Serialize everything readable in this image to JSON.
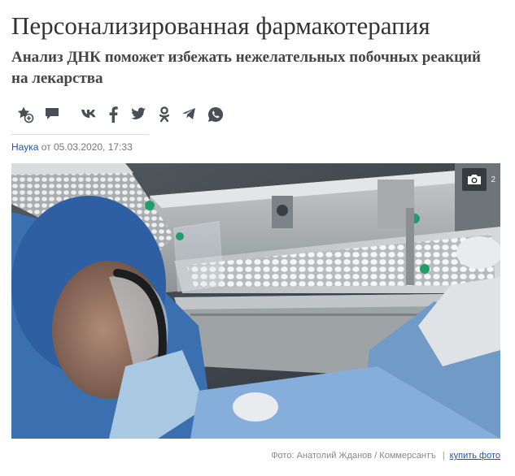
{
  "article": {
    "title": "Персонализированная фармакотерапия",
    "subtitle": "Анализ ДНК поможет избежать нежелательных побочных реакций на лекарства"
  },
  "toolbar": {
    "icons": [
      "favorite-add-icon",
      "comment-icon",
      "vk-icon",
      "facebook-icon",
      "twitter-icon",
      "odnoklassniki-icon",
      "telegram-icon",
      "whatsapp-icon"
    ]
  },
  "meta": {
    "rubric": "Наука",
    "date_prefix": "от",
    "date": "05.03.2020, 17:33"
  },
  "photo": {
    "gallery_count": "2",
    "gallery_icon": "camera-icon",
    "credit": "Фото: Анатолий Жданов / Коммерсантъ",
    "separator": "|",
    "buy_link": "купить фото"
  },
  "colors": {
    "link": "#1f57a4",
    "icon": "#4a4f57",
    "title": "#333333"
  }
}
